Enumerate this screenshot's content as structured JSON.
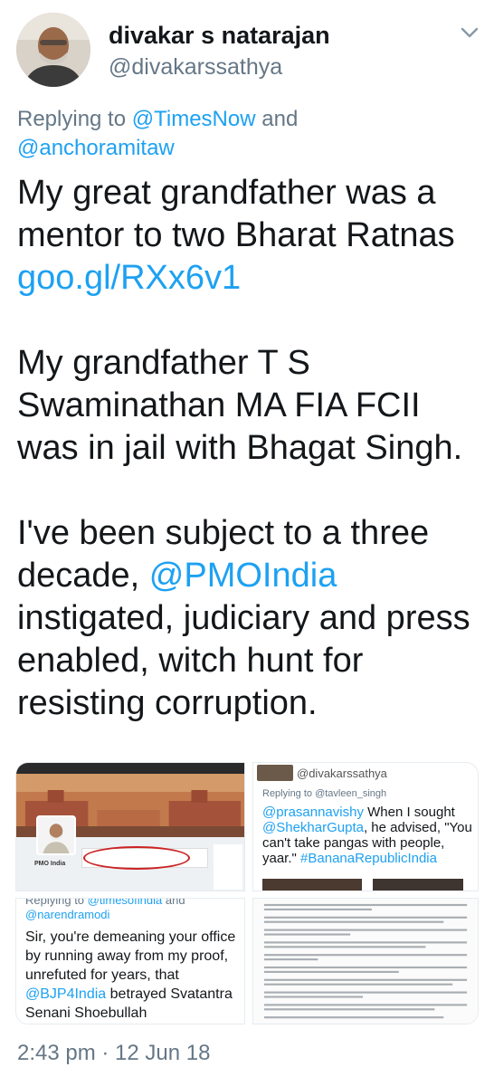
{
  "user": {
    "display_name": "divakar s natarajan",
    "handle": "@divakarssathya"
  },
  "reply_context": {
    "prefix": "Replying to",
    "mention_1": "@TimesNow",
    "joiner": "and",
    "mention_2": "@anchoramitaw"
  },
  "tweet": {
    "p1_text": "My great grandfather was a mentor to two Bharat Ratnas",
    "p1_link": "goo.gl/RXx6v1",
    "p2_text": "My grandfather T S Swaminathan MA FIA FCII was in jail with Bhagat Singh.",
    "p3_before": "I've been subject to a three decade,",
    "p3_mention": "@PMOIndia",
    "p3_after": "instigated, judiciary and press enabled, witch hunt for resisting corruption."
  },
  "media": {
    "tile1": {
      "profile_name": "PMO India"
    },
    "tile2": {
      "handle": "@divakarssathya",
      "replying": "Replying to @tavleen_singh",
      "mention_a": "@prasannavishy",
      "text_a": "When I sought",
      "mention_b": "@ShekharGupta",
      "text_b": ", he advised, \"You can't take pangas with people, yaar.\"",
      "hashtag": "#BananaRepublicIndia"
    },
    "tile3": {
      "replying_prefix": "Replying to",
      "mention_1": "@timesofindia",
      "joiner": "and",
      "mention_2": "@narendramodi",
      "text_a": "Sir, you're demeaning your office by running away from my proof, unrefuted for years, that",
      "mention_3": "@BJP4India",
      "text_b": "betrayed Svatantra Senani Shoebullah"
    }
  },
  "timestamp": "2:43 pm · 12 Jun 18",
  "colors": {
    "link": "#1da1f2",
    "secondary": "#657786",
    "text": "#14171a"
  }
}
